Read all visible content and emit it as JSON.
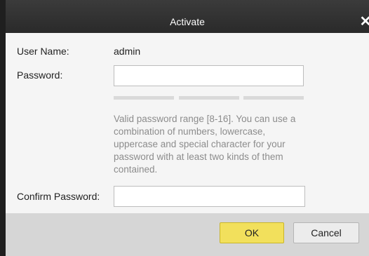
{
  "dialog": {
    "title": "Activate",
    "close_glyph": "✕"
  },
  "form": {
    "username_label": "User Name:",
    "username_value": "admin",
    "password_label": "Password:",
    "password_value": "",
    "password_strength_segments": 3,
    "hint_text": "Valid password range [8-16]. You can use a combination of numbers, lowercase, uppercase and special character for your password with at least two kinds of them contained.",
    "confirm_label": "Confirm Password:",
    "confirm_value": ""
  },
  "buttons": {
    "ok_label": "OK",
    "cancel_label": "Cancel"
  },
  "colors": {
    "titlebar": "#2a2a2a",
    "ok_button": "#f2e05c",
    "hint_text": "#8c8c8c"
  }
}
